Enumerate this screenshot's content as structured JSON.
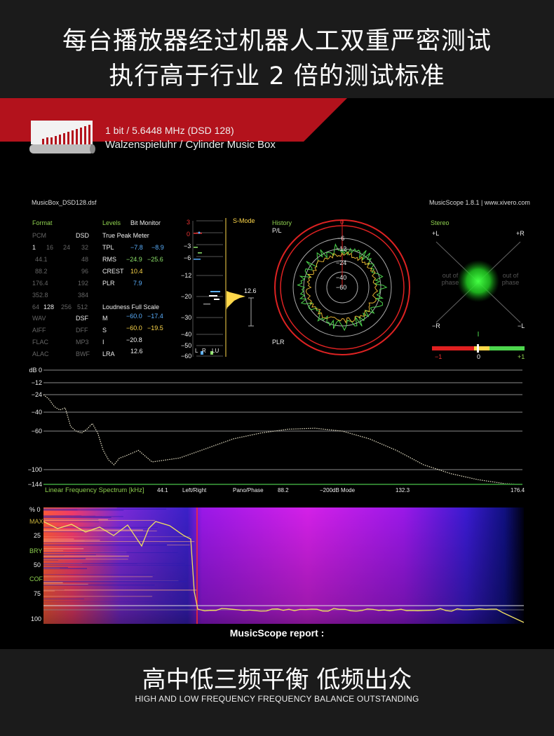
{
  "header": {
    "line1": "每台播放器经过机器人工双重严密测试",
    "line2": "执行高于行业 2 倍的测试标准"
  },
  "banner": {
    "format": "1 bit / 5.6448 MHz (DSD 128)",
    "title": "Walzenspieluhr / Cylinder Music Box"
  },
  "musicscope": {
    "filename": "MusicBox_DSD128.dsf",
    "version": "MusicScope 1.8.1 | www.xivero.com",
    "format_panel": {
      "title": "Format",
      "col1_header": "PCM",
      "col2_header": "DSD",
      "rows": [
        {
          "a": "1",
          "b": "16",
          "c": "24",
          "d": "32"
        },
        {
          "a": "44.1",
          "d": "48"
        },
        {
          "a": "88.2",
          "d": "96"
        },
        {
          "a": "176.4",
          "d": "192"
        },
        {
          "a": "352.8",
          "d": "384"
        },
        {
          "a": "64",
          "b": "128",
          "c": "256",
          "d": "512"
        }
      ],
      "file_types": [
        {
          "a": "WAV",
          "b": "DSF"
        },
        {
          "a": "AIFF",
          "b": "DFF"
        },
        {
          "a": "FLAC",
          "b": "MP3"
        },
        {
          "a": "ALAC",
          "b": "BWF"
        }
      ]
    },
    "levels_panel": {
      "title": "Levels",
      "bit_monitor": "Bit Monitor",
      "true_peak": "True Peak Meter",
      "tpl": {
        "label": "TPL",
        "v1": "−7.8",
        "v2": "−8.9"
      },
      "rms": {
        "label": "RMS",
        "v1": "−24.9",
        "v2": "−25.6"
      },
      "crest": {
        "label": "CREST",
        "v1": "10.4"
      },
      "plr": {
        "label": "PLR",
        "v1": "7.9"
      },
      "loudness": "Loudness Full Scale",
      "m": {
        "label": "M",
        "v1": "−60.0",
        "v2": "−17.4"
      },
      "s": {
        "label": "S",
        "v1": "−60.0",
        "v2": "−19.5"
      },
      "i": {
        "label": "I",
        "v1": "−20.8"
      },
      "lra": {
        "label": "LRA",
        "v1": "12.6"
      }
    },
    "meter": {
      "ticks": [
        "3",
        "0",
        "−3",
        "−6",
        "−12",
        "−20",
        "−30",
        "−40",
        "−50",
        "−60"
      ],
      "smode": "S-Mode",
      "readout": "12.6",
      "channels": [
        "L",
        "R",
        "LU"
      ]
    },
    "history": {
      "title": "History",
      "pl": "P/L",
      "plr": "PLR",
      "rings": [
        "0",
        "−6",
        "−12",
        "−24",
        "−40",
        "−60"
      ]
    },
    "stereo": {
      "title": "Stereo",
      "tl": "+L",
      "tr": "+R",
      "bl": "−R",
      "br": "−L",
      "out_left": "out of phase",
      "out_right": "out of phase",
      "scale_left": "−1",
      "scale_mid": "0",
      "scale_right": "+1"
    },
    "spectrum": {
      "db_labels": [
        "dB 0",
        "−12",
        "−24",
        "−40",
        "−60",
        "−100",
        "−144"
      ],
      "legend": "Linear Frequency Spectrum [kHz]",
      "tabs": [
        "44.1",
        "Left/Right",
        "Pano/Phase",
        "88.2",
        "−200dB Mode",
        "132.3",
        "176.4"
      ]
    },
    "spectrogram": {
      "labels": [
        "% 0",
        "MAX",
        "25",
        "BRY",
        "50",
        "COF",
        "75",
        "100"
      ]
    },
    "report": "MusicScope report :"
  },
  "footer": {
    "title": "高中低三频平衡 低频出众",
    "subtitle": "HIGH AND LOW FREQUENCY FREQUENCY BALANCE OUTSTANDING"
  },
  "colors": {
    "banner_red": "#b3121c",
    "ms_green": "#8fd14f",
    "ms_blue": "#5ab0ff",
    "ms_yellow": "#ffd84a"
  },
  "chart_data": {
    "type": "line",
    "x": [
      0,
      2,
      4,
      6,
      8,
      10,
      12,
      14,
      16,
      18,
      20,
      22,
      24,
      26,
      28,
      30,
      35,
      40,
      50,
      60,
      70,
      80,
      90,
      100,
      110,
      120,
      130,
      140,
      150,
      160,
      170,
      176.4
    ],
    "series": [
      {
        "values": [
          -24,
          -28,
          -35,
          -38,
          -36,
          -55,
          -60,
          -62,
          -58,
          -52,
          -62,
          -80,
          -90,
          -95,
          -88,
          -86,
          -80,
          -92,
          -88,
          -78,
          -68,
          -62,
          -58,
          -57,
          -60,
          -68,
          -80,
          -95,
          -112,
          -130,
          -142,
          -144
        ]
      }
    ],
    "ylim": [
      -144,
      0
    ],
    "xlim": [
      0,
      176.4
    ]
  }
}
